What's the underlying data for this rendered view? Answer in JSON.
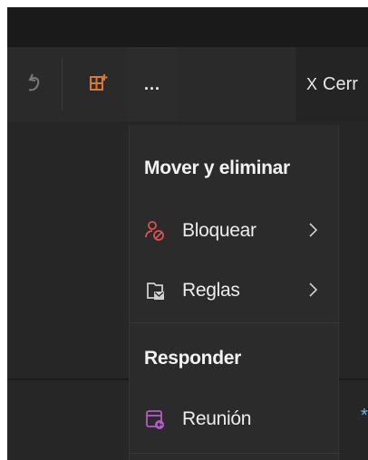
{
  "toolbar": {
    "undo_icon": "undo-icon",
    "addin_icon": "add-in-grid-icon",
    "more_label": "...",
    "close_label": "Cerr",
    "close_icon_glyph": "X"
  },
  "menu": {
    "section1_header": "Mover y eliminar",
    "items1": [
      {
        "label": "Bloquear",
        "icon": "block-person-icon",
        "has_submenu": true
      },
      {
        "label": "Reglas",
        "icon": "rules-icon",
        "has_submenu": true
      }
    ],
    "section2_header": "Responder",
    "items2": [
      {
        "label": "Reunión",
        "icon": "meeting-icon",
        "has_submenu": false
      }
    ]
  },
  "colors": {
    "accent_orange": "#d9773a",
    "block_red": "#e0504f",
    "meeting_purple": "#b45cc8"
  },
  "edge": {
    "glyph": "*"
  }
}
